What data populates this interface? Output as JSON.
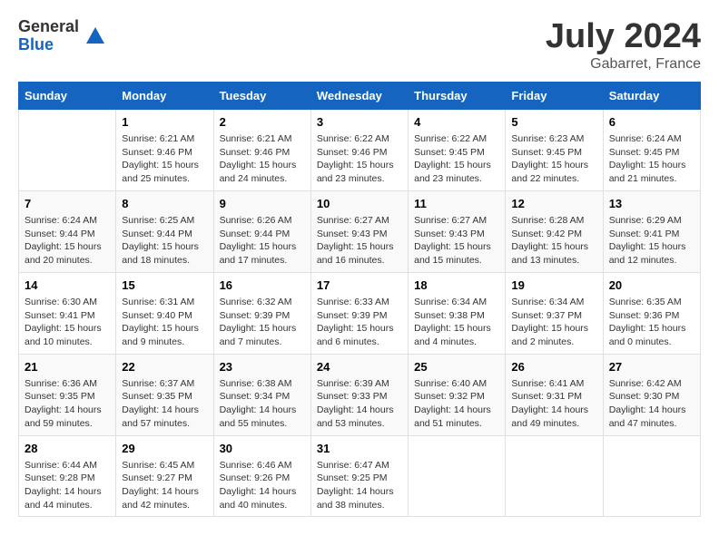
{
  "logo": {
    "general": "General",
    "blue": "Blue"
  },
  "title": {
    "month": "July 2024",
    "location": "Gabarret, France"
  },
  "headers": [
    "Sunday",
    "Monday",
    "Tuesday",
    "Wednesday",
    "Thursday",
    "Friday",
    "Saturday"
  ],
  "weeks": [
    [
      {
        "day": "",
        "info": ""
      },
      {
        "day": "1",
        "info": "Sunrise: 6:21 AM\nSunset: 9:46 PM\nDaylight: 15 hours\nand 25 minutes."
      },
      {
        "day": "2",
        "info": "Sunrise: 6:21 AM\nSunset: 9:46 PM\nDaylight: 15 hours\nand 24 minutes."
      },
      {
        "day": "3",
        "info": "Sunrise: 6:22 AM\nSunset: 9:46 PM\nDaylight: 15 hours\nand 23 minutes."
      },
      {
        "day": "4",
        "info": "Sunrise: 6:22 AM\nSunset: 9:45 PM\nDaylight: 15 hours\nand 23 minutes."
      },
      {
        "day": "5",
        "info": "Sunrise: 6:23 AM\nSunset: 9:45 PM\nDaylight: 15 hours\nand 22 minutes."
      },
      {
        "day": "6",
        "info": "Sunrise: 6:24 AM\nSunset: 9:45 PM\nDaylight: 15 hours\nand 21 minutes."
      }
    ],
    [
      {
        "day": "7",
        "info": "Sunrise: 6:24 AM\nSunset: 9:44 PM\nDaylight: 15 hours\nand 20 minutes."
      },
      {
        "day": "8",
        "info": "Sunrise: 6:25 AM\nSunset: 9:44 PM\nDaylight: 15 hours\nand 18 minutes."
      },
      {
        "day": "9",
        "info": "Sunrise: 6:26 AM\nSunset: 9:44 PM\nDaylight: 15 hours\nand 17 minutes."
      },
      {
        "day": "10",
        "info": "Sunrise: 6:27 AM\nSunset: 9:43 PM\nDaylight: 15 hours\nand 16 minutes."
      },
      {
        "day": "11",
        "info": "Sunrise: 6:27 AM\nSunset: 9:43 PM\nDaylight: 15 hours\nand 15 minutes."
      },
      {
        "day": "12",
        "info": "Sunrise: 6:28 AM\nSunset: 9:42 PM\nDaylight: 15 hours\nand 13 minutes."
      },
      {
        "day": "13",
        "info": "Sunrise: 6:29 AM\nSunset: 9:41 PM\nDaylight: 15 hours\nand 12 minutes."
      }
    ],
    [
      {
        "day": "14",
        "info": "Sunrise: 6:30 AM\nSunset: 9:41 PM\nDaylight: 15 hours\nand 10 minutes."
      },
      {
        "day": "15",
        "info": "Sunrise: 6:31 AM\nSunset: 9:40 PM\nDaylight: 15 hours\nand 9 minutes."
      },
      {
        "day": "16",
        "info": "Sunrise: 6:32 AM\nSunset: 9:39 PM\nDaylight: 15 hours\nand 7 minutes."
      },
      {
        "day": "17",
        "info": "Sunrise: 6:33 AM\nSunset: 9:39 PM\nDaylight: 15 hours\nand 6 minutes."
      },
      {
        "day": "18",
        "info": "Sunrise: 6:34 AM\nSunset: 9:38 PM\nDaylight: 15 hours\nand 4 minutes."
      },
      {
        "day": "19",
        "info": "Sunrise: 6:34 AM\nSunset: 9:37 PM\nDaylight: 15 hours\nand 2 minutes."
      },
      {
        "day": "20",
        "info": "Sunrise: 6:35 AM\nSunset: 9:36 PM\nDaylight: 15 hours\nand 0 minutes."
      }
    ],
    [
      {
        "day": "21",
        "info": "Sunrise: 6:36 AM\nSunset: 9:35 PM\nDaylight: 14 hours\nand 59 minutes."
      },
      {
        "day": "22",
        "info": "Sunrise: 6:37 AM\nSunset: 9:35 PM\nDaylight: 14 hours\nand 57 minutes."
      },
      {
        "day": "23",
        "info": "Sunrise: 6:38 AM\nSunset: 9:34 PM\nDaylight: 14 hours\nand 55 minutes."
      },
      {
        "day": "24",
        "info": "Sunrise: 6:39 AM\nSunset: 9:33 PM\nDaylight: 14 hours\nand 53 minutes."
      },
      {
        "day": "25",
        "info": "Sunrise: 6:40 AM\nSunset: 9:32 PM\nDaylight: 14 hours\nand 51 minutes."
      },
      {
        "day": "26",
        "info": "Sunrise: 6:41 AM\nSunset: 9:31 PM\nDaylight: 14 hours\nand 49 minutes."
      },
      {
        "day": "27",
        "info": "Sunrise: 6:42 AM\nSunset: 9:30 PM\nDaylight: 14 hours\nand 47 minutes."
      }
    ],
    [
      {
        "day": "28",
        "info": "Sunrise: 6:44 AM\nSunset: 9:28 PM\nDaylight: 14 hours\nand 44 minutes."
      },
      {
        "day": "29",
        "info": "Sunrise: 6:45 AM\nSunset: 9:27 PM\nDaylight: 14 hours\nand 42 minutes."
      },
      {
        "day": "30",
        "info": "Sunrise: 6:46 AM\nSunset: 9:26 PM\nDaylight: 14 hours\nand 40 minutes."
      },
      {
        "day": "31",
        "info": "Sunrise: 6:47 AM\nSunset: 9:25 PM\nDaylight: 14 hours\nand 38 minutes."
      },
      {
        "day": "",
        "info": ""
      },
      {
        "day": "",
        "info": ""
      },
      {
        "day": "",
        "info": ""
      }
    ]
  ]
}
